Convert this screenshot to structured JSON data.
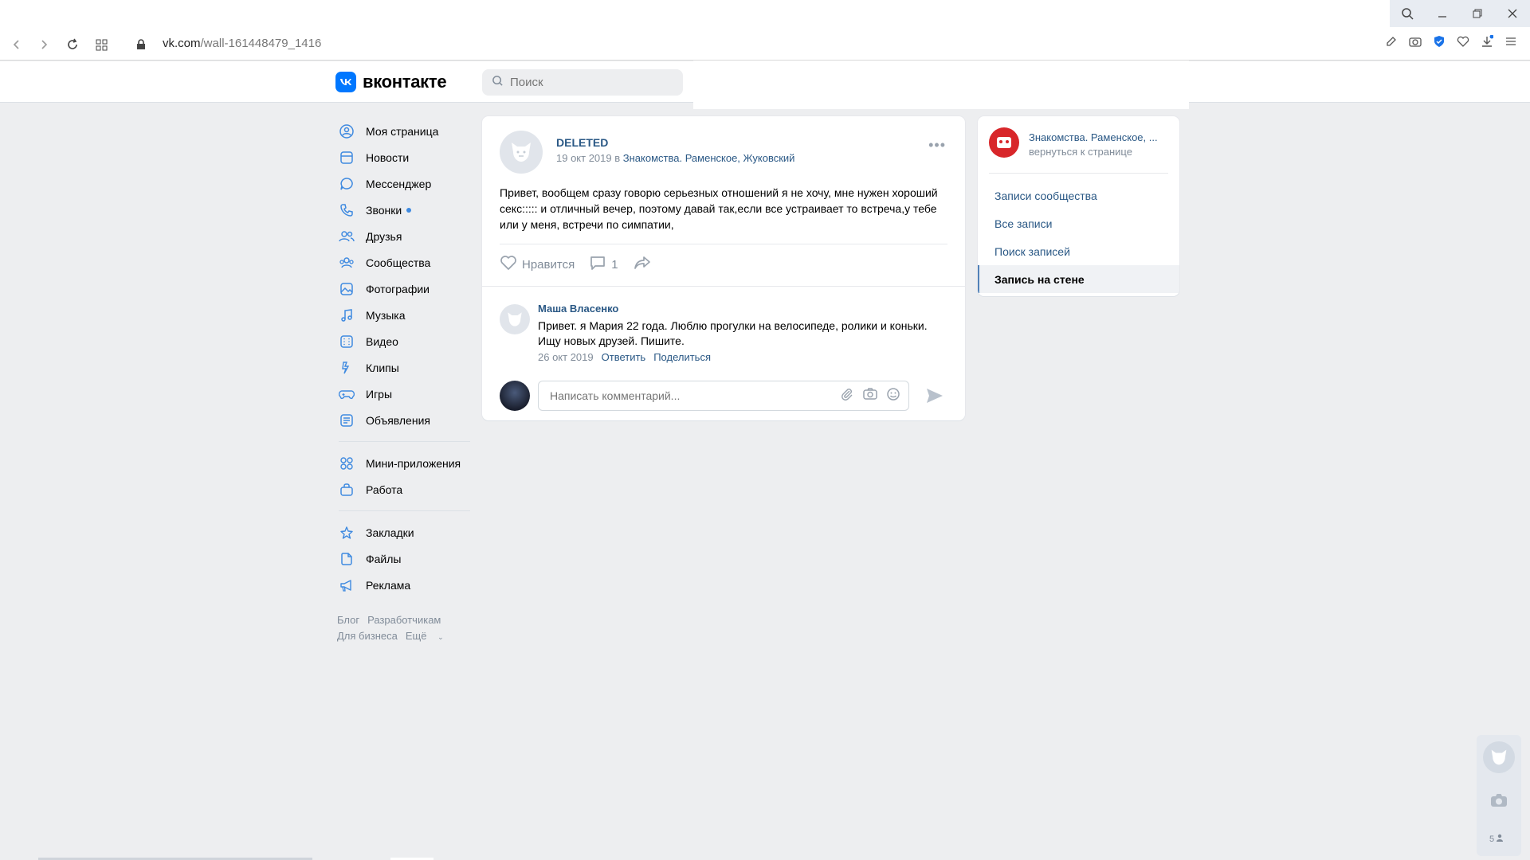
{
  "browser": {
    "url_host": "vk.com",
    "url_path": "/wall-161448479_1416"
  },
  "header": {
    "logo_text": "вконтакте",
    "search_placeholder": "Поиск"
  },
  "left_menu": {
    "items": [
      {
        "label": "Моя страница",
        "icon": "user-circle-icon"
      },
      {
        "label": "Новости",
        "icon": "news-icon"
      },
      {
        "label": "Мессенджер",
        "icon": "message-icon"
      },
      {
        "label": "Звонки",
        "icon": "phone-icon"
      },
      {
        "label": "Друзья",
        "icon": "friends-icon"
      },
      {
        "label": "Сообщества",
        "icon": "communities-icon"
      },
      {
        "label": "Фотографии",
        "icon": "photo-icon"
      },
      {
        "label": "Музыка",
        "icon": "music-icon"
      },
      {
        "label": "Видео",
        "icon": "video-icon"
      },
      {
        "label": "Клипы",
        "icon": "clips-icon"
      },
      {
        "label": "Игры",
        "icon": "gamepad-icon"
      },
      {
        "label": "Объявления",
        "icon": "ads-icon"
      }
    ],
    "items2": [
      {
        "label": "Мини-приложения",
        "icon": "apps-icon"
      },
      {
        "label": "Работа",
        "icon": "briefcase-icon"
      }
    ],
    "items3": [
      {
        "label": "Закладки",
        "icon": "star-icon"
      },
      {
        "label": "Файлы",
        "icon": "file-icon"
      },
      {
        "label": "Реклама",
        "icon": "megaphone-icon"
      }
    ],
    "footer": {
      "blog": "Блог",
      "developers": "Разработчикам",
      "business": "Для бизнеса",
      "more": "Ещё"
    }
  },
  "post": {
    "author": "DELETED",
    "date": "19 окт 2019 в",
    "group": "Знакомства. Раменское, Жуковский",
    "more": "•••",
    "text": "Привет, вообщем сразу говорю серьезных отношений я не хочу, мне нужен хороший секс::::: и отличный вечер, поэтому давай так,если все устраивает то встреча,у тебе или у меня, встречи по симпатии,",
    "like_label": "Нравится",
    "comment_count": "1"
  },
  "comment": {
    "author": "Маша Власенко",
    "text": "Привет. я Мария 22 года. Люблю прогулки на велосипеде, ролики и коньки. Ищу новых друзей. Пишите.",
    "date": "26 окт 2019",
    "reply": "Ответить",
    "share": "Поделиться"
  },
  "composer": {
    "placeholder": "Написать комментарий..."
  },
  "right_nav": {
    "group_name": "Знакомства. Раменское, ...",
    "back": "вернуться к странице",
    "items": [
      "Записи сообщества",
      "Все записи",
      "Поиск записей",
      "Запись на стене"
    ]
  },
  "widget": {
    "count": "5"
  },
  "colors": {
    "accent": "#0077ff",
    "link": "#2a5885",
    "icon": "#3f8ae0"
  }
}
